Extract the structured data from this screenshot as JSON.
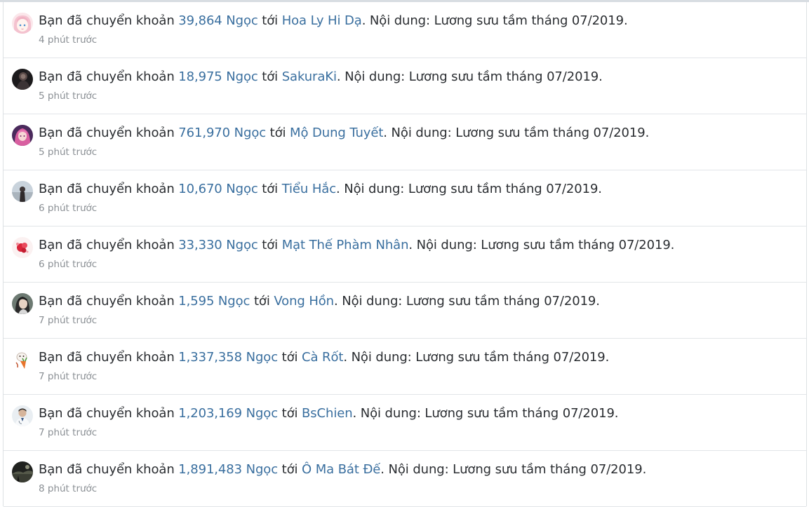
{
  "transfers": [
    {
      "prefix": "Bạn đã chuyển khoản ",
      "amount": "39,864 Ngọc",
      "to_word": " tới ",
      "recipient": "Hoa Ly Hi Dạ",
      "content": ". Nội dung: Lương sưu tầm tháng 07/2019.",
      "time": "4 phút trước",
      "avatar_icon": "anime-girl-avatar-icon"
    },
    {
      "prefix": "Bạn đã chuyển khoản ",
      "amount": "18,975 Ngọc",
      "to_word": " tới ",
      "recipient": "SakuraKi",
      "content": ". Nội dung: Lương sưu tầm tháng 07/2019.",
      "time": "5 phút trước",
      "avatar_icon": "dark-figure-avatar-icon"
    },
    {
      "prefix": "Bạn đã chuyển khoản ",
      "amount": "761,970 Ngọc",
      "to_word": " tới ",
      "recipient": "Mộ Dung Tuyết",
      "content": ". Nội dung: Lương sưu tầm tháng 07/2019.",
      "time": "5 phút trước",
      "avatar_icon": "pink-hair-avatar-icon"
    },
    {
      "prefix": "Bạn đã chuyển khoản ",
      "amount": "10,670 Ngọc",
      "to_word": " tới ",
      "recipient": "Tiểu Hắc",
      "content": ". Nội dung: Lương sưu tầm tháng 07/2019.",
      "time": "6 phút trước",
      "avatar_icon": "misty-figure-avatar-icon"
    },
    {
      "prefix": "Bạn đã chuyển khoản ",
      "amount": "33,330 Ngọc",
      "to_word": " tới ",
      "recipient": "Mạt Thế Phàm Nhân",
      "content": ". Nội dung: Lương sưu tầm tháng 07/2019.",
      "time": "6 phút trước",
      "avatar_icon": "red-flower-avatar-icon"
    },
    {
      "prefix": "Bạn đã chuyển khoản ",
      "amount": "1,595 Ngọc",
      "to_word": " tới ",
      "recipient": "Vong Hồn",
      "content": ". Nội dung: Lương sưu tầm tháng 07/2019.",
      "time": "7 phút trước",
      "avatar_icon": "portrait-avatar-icon"
    },
    {
      "prefix": "Bạn đã chuyển khoản ",
      "amount": "1,337,358 Ngọc",
      "to_word": " tới ",
      "recipient": "Cà Rốt",
      "content": ". Nội dung: Lương sưu tầm tháng 07/2019.",
      "time": "7 phút trước",
      "avatar_icon": "cartoon-carrot-avatar-icon"
    },
    {
      "prefix": "Bạn đã chuyển khoản ",
      "amount": "1,203,169 Ngọc",
      "to_word": " tới ",
      "recipient": "BsChien",
      "content": ". Nội dung: Lương sưu tầm tháng 07/2019.",
      "time": "7 phút trước",
      "avatar_icon": "doctor-avatar-icon"
    },
    {
      "prefix": "Bạn đã chuyển khoản ",
      "amount": "1,891,483 Ngọc",
      "to_word": " tới ",
      "recipient": "Ô Ma Bát Đế",
      "content": ". Nội dung: Lương sưu tầm tháng 07/2019.",
      "time": "8 phút trước",
      "avatar_icon": "dark-scene-avatar-icon"
    }
  ],
  "colors": {
    "link": "#3a6f9f",
    "text": "#2a2d31",
    "muted": "#8a8f94",
    "divider": "#e2e5e8"
  }
}
